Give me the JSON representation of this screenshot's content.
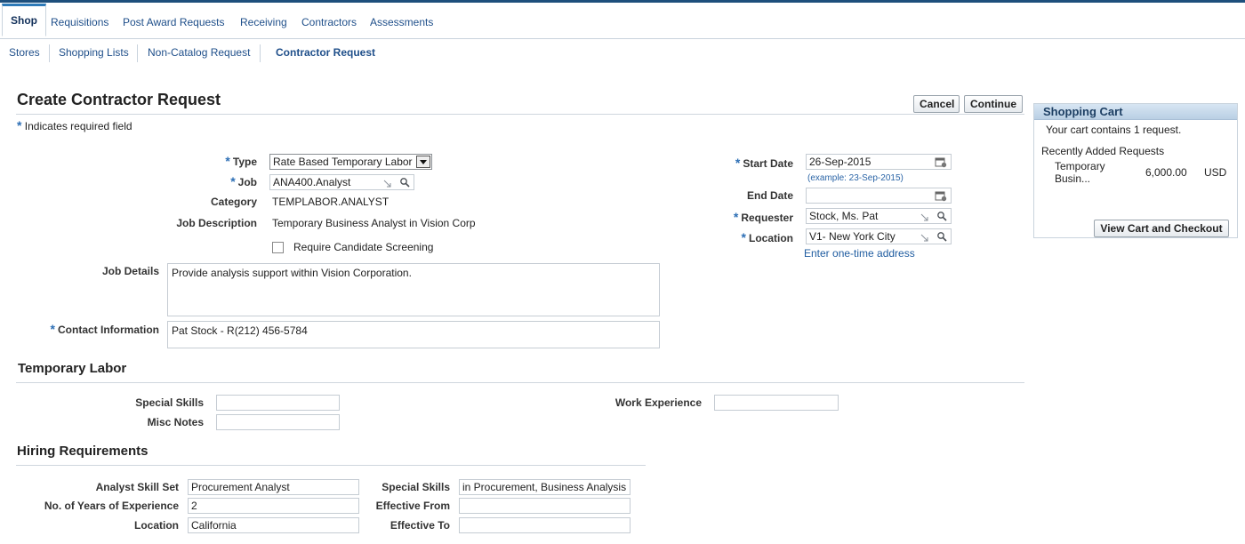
{
  "tabs": [
    "Shop",
    "Requisitions",
    "Post Award Requests",
    "Receiving",
    "Contractors",
    "Assessments"
  ],
  "subnav": [
    "Stores",
    "Shopping Lists",
    "Non-Catalog Request",
    "Contractor Request"
  ],
  "page": {
    "title": "Create Contractor Request",
    "required_note": "Indicates required field",
    "required_marker": "*",
    "cancel_label": "Cancel",
    "continue_label": "Continue"
  },
  "form": {
    "type_label": "Type",
    "type_value": "Rate Based Temporary Labor",
    "job_label": "Job",
    "job_value": "ANA400.Analyst",
    "category_label": "Category",
    "category_value": "TEMPLABOR.ANALYST",
    "job_description_label": "Job Description",
    "job_description_value": "Temporary Business Analyst in Vision Corp",
    "screening_label": "Require Candidate Screening",
    "screening_checked": false,
    "start_date_label": "Start Date",
    "start_date_value": "26-Sep-2015",
    "date_example": "(example: 23-Sep-2015)",
    "end_date_label": "End Date",
    "end_date_value": "",
    "requester_label": "Requester",
    "requester_value": "Stock, Ms. Pat",
    "location_label": "Location",
    "location_value": "V1- New York City",
    "one_time_address_link": "Enter one-time address",
    "job_details_label": "Job Details",
    "job_details_value": "Provide analysis support within Vision Corporation.",
    "contact_label": "Contact Information",
    "contact_value": "Pat Stock  - R(212) 456-5784"
  },
  "temporary_labor": {
    "heading": "Temporary Labor",
    "special_skills_label": "Special Skills",
    "special_skills_value": "",
    "misc_notes_label": "Misc Notes",
    "misc_notes_value": "",
    "work_experience_label": "Work Experience",
    "work_experience_value": ""
  },
  "hiring": {
    "heading": "Hiring Requirements",
    "analyst_skill_set_label": "Analyst Skill Set",
    "analyst_skill_set_value": "Procurement Analyst",
    "years_label": "No. of Years of Experience",
    "years_value": "2",
    "location_label": "Location",
    "location_value": "California",
    "special_skills_label": "Special Skills",
    "special_skills_value": "in Procurement, Business Analysis",
    "effective_from_label": "Effective From",
    "effective_from_value": "",
    "effective_to_label": "Effective To",
    "effective_to_value": ""
  },
  "cart": {
    "title": "Shopping Cart",
    "summary": "Your cart contains 1 request.",
    "recent_heading": "Recently Added Requests",
    "item_name_line1": "Temporary",
    "item_name_line2": "Busin...",
    "item_amount": "6,000.00",
    "item_currency": "USD",
    "checkout_label": "View Cart and Checkout"
  },
  "icons": [
    "calendar-icon",
    "search-icon",
    "dropdown-arrow-icon",
    "lov-resize-icon"
  ],
  "colors": {
    "accent": "#2d6fb5",
    "link": "#1f5ca0",
    "tab_border": "#2d7ab8",
    "top_bar": "#1d4f7c"
  }
}
